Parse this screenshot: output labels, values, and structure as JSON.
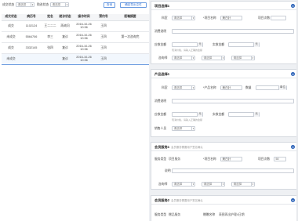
{
  "filters": {
    "deal_status_label": "成交状态",
    "deal_status_value": "请选择",
    "purchase_status_label": "购进状态",
    "purchase_status_value": "请选择",
    "search_button": "查询",
    "export_button": "确定导出文件"
  },
  "table": {
    "headers": [
      "成交状态",
      "病历号",
      "姓名",
      "就诊状态",
      "操作时间",
      "预约号",
      "医嘱摘要"
    ],
    "rows": [
      {
        "status": "成交",
        "record": "1102124",
        "name": "王二二二",
        "visit": "再询问",
        "time1": "2016-10-26",
        "time2": "10:36",
        "appt": "王四",
        "note": ""
      },
      {
        "status": "未成交",
        "record": "5564706",
        "name": "李三",
        "visit": "复诊",
        "time1": "2016-10-26",
        "time2": "10:36",
        "appt": "王四",
        "note": "第一次咨询完"
      },
      {
        "status": "成交",
        "record": "3332145",
        "name": "张四",
        "visit": "复诊",
        "time1": "2016-10-26",
        "time2": "10:36",
        "appt": "王四",
        "note": ""
      },
      {
        "status": "未成交",
        "record": "",
        "name": "",
        "visit": "复诊",
        "time1": "2016-10-26",
        "time2": "10:36",
        "appt": "王四",
        "note": ""
      }
    ]
  },
  "project_card": {
    "title": "项目选择1",
    "dept_label": "科室",
    "dept_value": "请选择",
    "name_label": "*项目名称",
    "name_value": "美白针",
    "count_label": "项目次数",
    "count_value": "",
    "desc_label": "消费说明",
    "receivable_label": "应收金额",
    "receivable_unit": "元",
    "receivable_hint": "现消价格，请输入正确的金额",
    "actual_label": "实收金额",
    "actual_unit": "元",
    "consultant_label": "咨询师",
    "consultant_value": "请选择",
    "sel2_value": "请选择",
    "sel3_value": "请选择"
  },
  "product_card": {
    "title": "产品选择1",
    "dept_label": "科室",
    "dept_value": "请选择",
    "name_label": "*产品名称",
    "name_value": "美白针",
    "qty_label": "数量",
    "qty_unit": "单位",
    "desc_label": "消费说明",
    "receivable_label": "应收金额",
    "receivable_unit": "元",
    "receivable_hint": "现消价格，请输入正确的金额",
    "actual_label": "实收金额",
    "actual_unit": "元",
    "sales_label": "销售人员",
    "sales_value": "请选择"
  },
  "service_card1": {
    "title": "会员服务1",
    "subtitle": "会员服务需要用户签名确认",
    "type_label": "服务类型",
    "type_value": "项目服务",
    "name_label": "*项目名称",
    "name_value": "美白针",
    "count_label": "项目次数",
    "count_value": "50",
    "desc_label": "说明",
    "consultant_label": "咨询师",
    "consultant_value": "请选择",
    "sel2_value": "请选择",
    "sel3_value": "请选择"
  },
  "service_card2": {
    "title": "会员服务2",
    "subtitle": "会员服务需要用户签名确认",
    "type_label": "服务类型",
    "type_value": "赠品服务",
    "name_label": "赠赠名称",
    "name_value": "表图再出护理4日期"
  }
}
